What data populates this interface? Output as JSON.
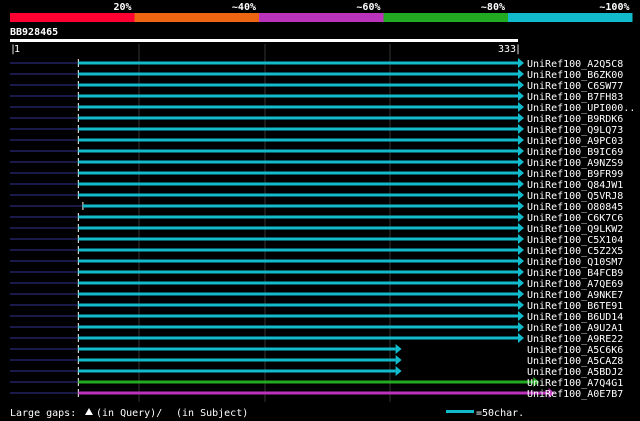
{
  "legend": {
    "ticks": [
      "20%",
      "~40%",
      "~60%",
      "~80%",
      "~100%"
    ],
    "colors": [
      "#ff0033",
      "#ee6611",
      "#bb33bb",
      "#22aa22",
      "#11bbcc"
    ]
  },
  "query": {
    "name": "BB928465",
    "start_label": "1",
    "end_label": "333"
  },
  "hits": [
    {
      "id": "UniRef100_A2Q5C8",
      "q_start": 45,
      "q_end": 333,
      "color": "#11bbcc"
    },
    {
      "id": "UniRef100_B6ZK00",
      "q_start": 45,
      "q_end": 333,
      "color": "#11bbcc"
    },
    {
      "id": "UniRef100_C6SW77",
      "q_start": 45,
      "q_end": 333,
      "color": "#11bbcc"
    },
    {
      "id": "UniRef100_B7FH83",
      "q_start": 45,
      "q_end": 333,
      "color": "#11bbcc"
    },
    {
      "id": "UniRef100_UPI000..",
      "q_start": 45,
      "q_end": 333,
      "color": "#11bbcc"
    },
    {
      "id": "UniRef100_B9RDK6",
      "q_start": 45,
      "q_end": 333,
      "color": "#11bbcc"
    },
    {
      "id": "UniRef100_Q9LQ73",
      "q_start": 45,
      "q_end": 333,
      "color": "#11bbcc"
    },
    {
      "id": "UniRef100_A9PC03",
      "q_start": 45,
      "q_end": 333,
      "color": "#11bbcc"
    },
    {
      "id": "UniRef100_B9IC69",
      "q_start": 45,
      "q_end": 333,
      "color": "#11bbcc"
    },
    {
      "id": "UniRef100_A9NZS9",
      "q_start": 45,
      "q_end": 333,
      "color": "#11bbcc"
    },
    {
      "id": "UniRef100_B9FR99",
      "q_start": 45,
      "q_end": 333,
      "color": "#11bbcc"
    },
    {
      "id": "UniRef100_Q84JW1",
      "q_start": 45,
      "q_end": 333,
      "color": "#11bbcc"
    },
    {
      "id": "UniRef100_Q5VRJ8",
      "q_start": 45,
      "q_end": 333,
      "color": "#11bbcc"
    },
    {
      "id": "UniRef100_O80845",
      "q_start": 48,
      "q_end": 333,
      "color": "#11bbcc"
    },
    {
      "id": "UniRef100_C6K7C6",
      "q_start": 45,
      "q_end": 333,
      "color": "#11bbcc"
    },
    {
      "id": "UniRef100_Q9LKW2",
      "q_start": 45,
      "q_end": 333,
      "color": "#11bbcc"
    },
    {
      "id": "UniRef100_C5X104",
      "q_start": 45,
      "q_end": 333,
      "color": "#11bbcc"
    },
    {
      "id": "UniRef100_C5Z2X5",
      "q_start": 45,
      "q_end": 333,
      "color": "#11bbcc"
    },
    {
      "id": "UniRef100_Q10SM7",
      "q_start": 45,
      "q_end": 333,
      "color": "#11bbcc"
    },
    {
      "id": "UniRef100_B4FCB9",
      "q_start": 45,
      "q_end": 333,
      "color": "#11bbcc"
    },
    {
      "id": "UniRef100_A7QE69",
      "q_start": 45,
      "q_end": 333,
      "color": "#11bbcc"
    },
    {
      "id": "UniRef100_A9NKE7",
      "q_start": 45,
      "q_end": 333,
      "color": "#11bbcc"
    },
    {
      "id": "UniRef100_B6TE91",
      "q_start": 45,
      "q_end": 333,
      "color": "#11bbcc"
    },
    {
      "id": "UniRef100_B6UD14",
      "q_start": 45,
      "q_end": 333,
      "color": "#11bbcc"
    },
    {
      "id": "UniRef100_A9U2A1",
      "q_start": 45,
      "q_end": 333,
      "color": "#11bbcc"
    },
    {
      "id": "UniRef100_A9RE22",
      "q_start": 45,
      "q_end": 333,
      "color": "#11bbcc"
    },
    {
      "id": "UniRef100_A5C6K6",
      "q_start": 45,
      "q_end": 253,
      "color": "#11bbcc"
    },
    {
      "id": "UniRef100_A5CAZ8",
      "q_start": 45,
      "q_end": 253,
      "color": "#11bbcc"
    },
    {
      "id": "UniRef100_A5BDJ2",
      "q_start": 45,
      "q_end": 253,
      "color": "#11bbcc"
    },
    {
      "id": "UniRef100_A7Q4G1",
      "q_start": 45,
      "q_end": 343,
      "color": "#22aa22"
    },
    {
      "id": "UniRef100_A0E7B7",
      "q_start": 45,
      "q_end": 353,
      "color": "#bb33bb"
    }
  ],
  "footer": {
    "gaps_label": "Large gaps:",
    "query_gap_label": "(in Query)/",
    "subject_gap_label": "(in Subject)",
    "scale_label": "=50char."
  }
}
